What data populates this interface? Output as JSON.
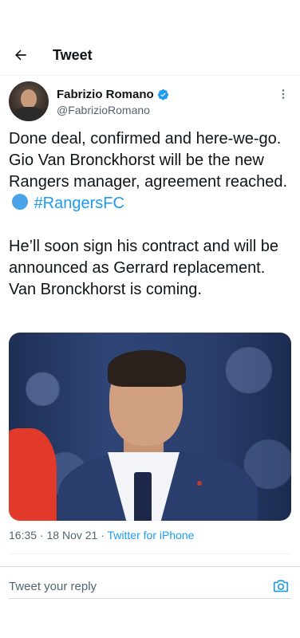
{
  "header": {
    "title": "Tweet",
    "back_icon": "arrow-left-icon"
  },
  "author": {
    "name": "Fabrizio Romano",
    "handle": "@FabrizioRomano",
    "verified": true,
    "verified_icon": "verified-badge-icon",
    "more_icon": "more-vertical-icon"
  },
  "tweet": {
    "para1_text": "Done deal, confirmed and here-we-go. Gio Van Bronckhorst will be the new Rangers manager, agreement reached.",
    "hashtag": "#RangersFC",
    "emoji_icon": "blue-circle-emoji",
    "para2_text": "He’ll soon sign his contract and will be announced as Gerrard replacement. Van Bronckhorst is coming."
  },
  "media": {
    "icon": "photo-icon"
  },
  "meta": {
    "time": "16:35",
    "date": "18 Nov 21",
    "separator": "·",
    "source": "Twitter for iPhone"
  },
  "reply": {
    "placeholder": "Tweet your reply",
    "camera_icon": "camera-icon"
  },
  "colors": {
    "accent": "#1d9bf0",
    "text": "#0f1419",
    "muted": "#536471",
    "border": "#eff3f4"
  }
}
